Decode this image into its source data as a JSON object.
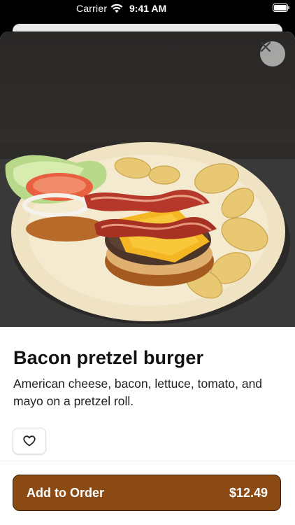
{
  "status_bar": {
    "carrier": "Carrier",
    "time": "9:41 AM"
  },
  "item": {
    "name": "Bacon pretzel burger",
    "description": "American cheese, bacon, lettuce, tomato, and mayo on a pretzel roll.",
    "image_alt": "Bacon pretzel burger with chips on a plate"
  },
  "actions": {
    "close_icon": "close-icon",
    "favorite_icon": "heart-icon",
    "add_to_order_label": "Add to Order",
    "price": "$12.49"
  },
  "colors": {
    "accent": "#8b4a14",
    "accent_border": "#3a1f08"
  }
}
